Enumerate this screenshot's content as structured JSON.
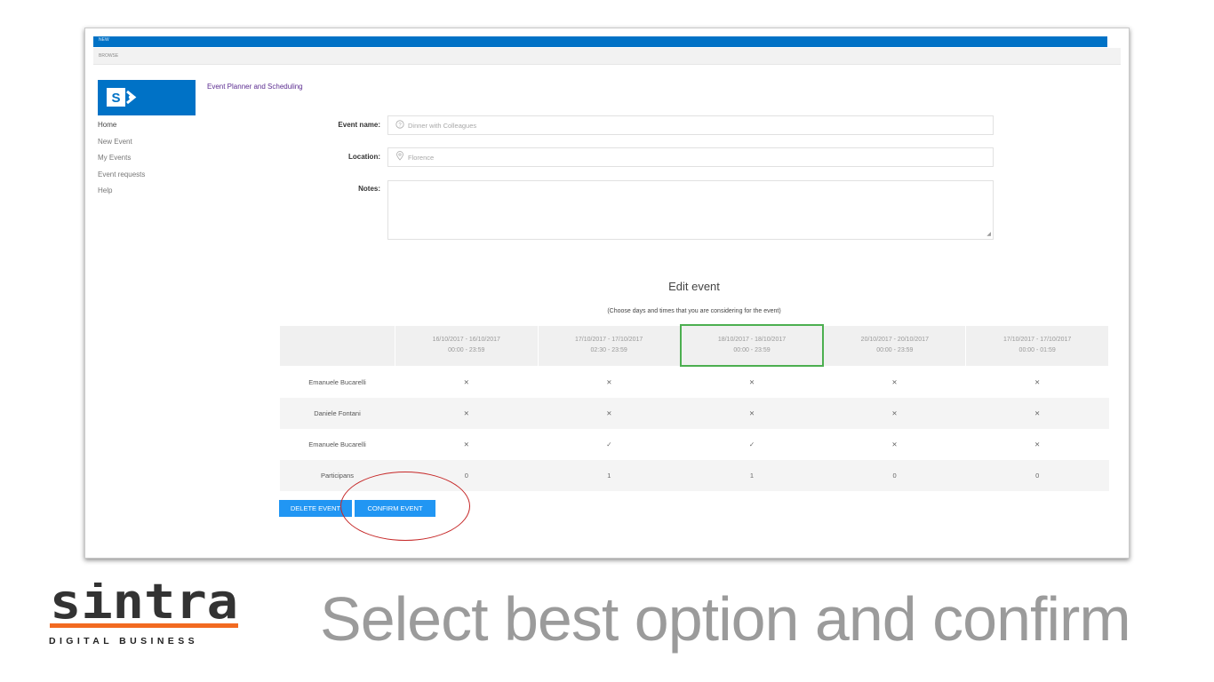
{
  "app": {
    "topbar_text": "NEW",
    "ribbon_text": "BROWSE",
    "site_title": "Event Planner and Scheduling"
  },
  "nav": {
    "items": [
      "Home",
      "New Event",
      "My Events",
      "Event requests",
      "Help"
    ]
  },
  "form": {
    "event_name_label": "Event name:",
    "event_name_placeholder": "Dinner with Colleagues",
    "location_label": "Location:",
    "location_placeholder": "Florence",
    "notes_label": "Notes:"
  },
  "edit": {
    "title": "Edit event",
    "subtitle": "(Choose days and times that you are considering for the event)",
    "columns": [
      {
        "dates": "16/10/2017 - 16/10/2017",
        "times": "00:00 - 23:59"
      },
      {
        "dates": "17/10/2017 - 17/10/2017",
        "times": "02:30 - 23:59"
      },
      {
        "dates": "18/10/2017 - 18/10/2017",
        "times": "00:00 - 23:59",
        "selected": true
      },
      {
        "dates": "20/10/2017 - 20/10/2017",
        "times": "00:00 - 23:59"
      },
      {
        "dates": "17/10/2017 - 17/10/2017",
        "times": "00:00 - 01:59"
      }
    ],
    "rows": [
      {
        "name": "Emanuele Bucarelli",
        "marks": [
          "✕",
          "✕",
          "✕",
          "✕",
          "✕"
        ]
      },
      {
        "name": "Daniele Fontani",
        "marks": [
          "✕",
          "✕",
          "✕",
          "✕",
          "✕"
        ]
      },
      {
        "name": "Emanuele Bucarelli",
        "marks": [
          "✕",
          "✓",
          "✓",
          "✕",
          "✕"
        ]
      }
    ],
    "participants_label": "Participans",
    "participants": [
      "0",
      "1",
      "1",
      "0",
      "0"
    ]
  },
  "buttons": {
    "delete_label": "DELETE EVENT",
    "confirm_label": "CONFIRM EVENT"
  },
  "brand": {
    "name": "sintra",
    "tagline": "DIGITAL BUSINESS",
    "bar_color": "#f26a21"
  },
  "headline": "Select best option and confirm",
  "colors": {
    "accent": "#0072c6",
    "button": "#2196f3",
    "selected_border": "#4caf50",
    "highlight_circle": "#c62828"
  }
}
